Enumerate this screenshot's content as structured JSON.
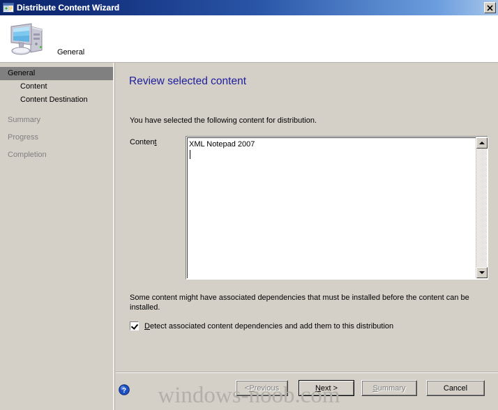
{
  "window": {
    "title": "Distribute Content Wizard",
    "title_icon": "wizard-window-icon",
    "close_label": "✕",
    "colors": {
      "titlebar_start": "#0a246a",
      "titlebar_end": "#a8c6ea",
      "dialog_face": "#d4d0c8",
      "heading": "#1d1d9c",
      "selection": "#0a246a",
      "disabled_text": "#808080"
    }
  },
  "header": {
    "icon": "computer-icon",
    "label": "General"
  },
  "sidebar": {
    "items": [
      {
        "label": "General",
        "state": "current",
        "indent": 0
      },
      {
        "label": "Content",
        "state": "done",
        "indent": 1
      },
      {
        "label": "Content Destination",
        "state": "done",
        "indent": 1
      },
      {
        "label": "Summary",
        "state": "pending",
        "indent": 0
      },
      {
        "label": "Progress",
        "state": "pending",
        "indent": 0
      },
      {
        "label": "Completion",
        "state": "pending",
        "indent": 0
      }
    ]
  },
  "main": {
    "page_title": "Review selected content",
    "intro_text": "You have selected the following content for distribution.",
    "content_label": "Content",
    "content_label_accel": "t",
    "content_list": [
      {
        "name": "XML Notepad 2007",
        "selected": true
      }
    ],
    "dependency_note": "Some content might have associated dependencies that must be installed before the content can be installed.",
    "dependency_checkbox": {
      "label": "Detect associated content dependencies and add them to this distribution",
      "accel": "D",
      "checked": true
    }
  },
  "scrollbar": {
    "up_arrow": "scroll-up-arrow-icon",
    "down_arrow": "scroll-down-arrow-icon"
  },
  "footer": {
    "help_icon": "help-question-icon",
    "buttons": [
      {
        "label": "< Previous",
        "accel": "P",
        "enabled": false,
        "default": false
      },
      {
        "label": "Next >",
        "accel": "N",
        "enabled": true,
        "default": true
      },
      {
        "label": "Summary",
        "accel": "S",
        "enabled": false,
        "default": false
      },
      {
        "label": "Cancel",
        "accel": "",
        "enabled": true,
        "default": false
      }
    ]
  },
  "watermark": "windows-noob.com"
}
